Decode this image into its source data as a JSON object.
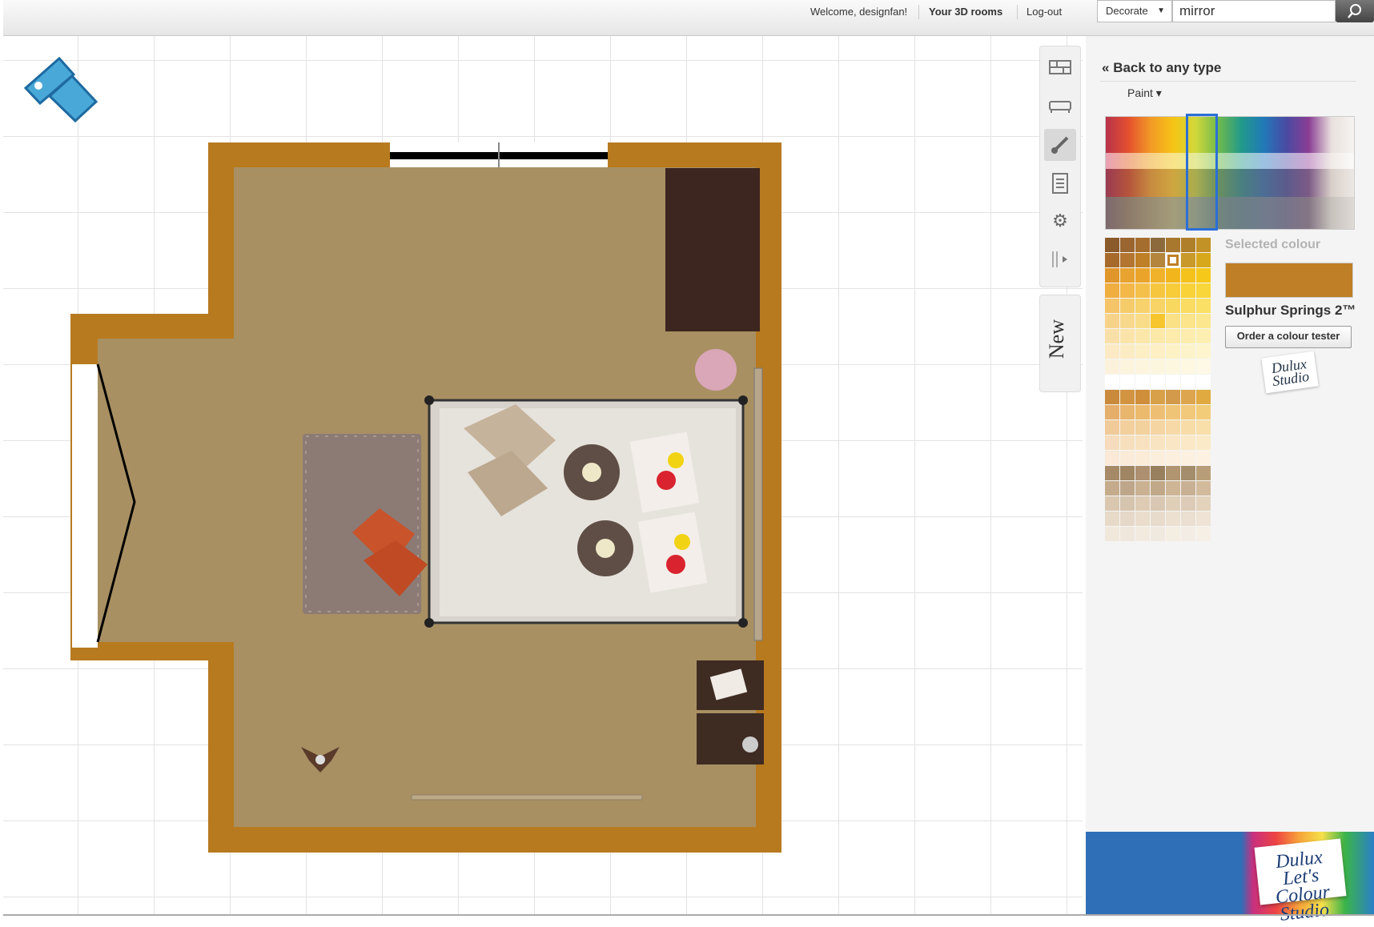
{
  "header": {
    "welcome": "Welcome, designfan!",
    "rooms_link": "Your 3D rooms",
    "logout_link": "Log-out",
    "mode_select": "Decorate",
    "search_value": "mirror"
  },
  "toolbar": {
    "items": [
      {
        "icon": "walls-icon"
      },
      {
        "icon": "furniture-icon"
      },
      {
        "icon": "paint-brush-icon",
        "active": true
      },
      {
        "icon": "clipboard-list-icon"
      },
      {
        "icon": "settings-gear-icon"
      },
      {
        "icon": "expand-arrow-icon"
      }
    ],
    "new_tab": "New"
  },
  "panel": {
    "back_link": "Back to any type",
    "back_chevron": "«",
    "type_select": "Paint ▾",
    "selected_label": "Selected colour",
    "selected_color_hex": "#bf7f26",
    "selected_color_name": "Sulphur Springs 2™",
    "order_tester": "Order a colour tester",
    "brand_small": "Dulux Studio",
    "banner_brand": "Dulux Let's Colour Studio"
  }
}
